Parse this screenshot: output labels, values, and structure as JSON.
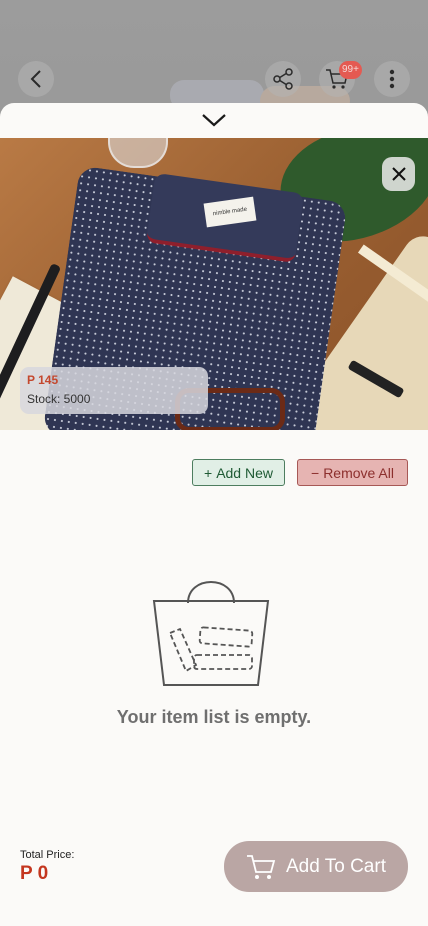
{
  "header": {
    "cart_badge": "99+",
    "icons": [
      "back-icon",
      "share-icon",
      "cart-icon",
      "more-vertical-icon"
    ]
  },
  "sheet": {
    "image": {
      "description_icons": [
        "close-icon"
      ],
      "brand_tag": "nimble made",
      "price": "P 145",
      "stock": "Stock: 5000"
    },
    "actions": {
      "add_new_symbol": "+",
      "add_new_label": "Add New",
      "remove_all_symbol": "−",
      "remove_all_label": "Remove All"
    },
    "empty_state": {
      "message": "Your item list is empty."
    },
    "footer": {
      "total_label": "Total Price:",
      "total_value": "P 0",
      "add_to_cart_label": "Add To Cart"
    }
  },
  "colors": {
    "price_red": "#c4361f",
    "add_new_bg": "#e1efe6",
    "remove_all_bg": "#e6b4b2",
    "cart_button_bg": "#baa6a4",
    "badge_red": "#e45a52"
  }
}
